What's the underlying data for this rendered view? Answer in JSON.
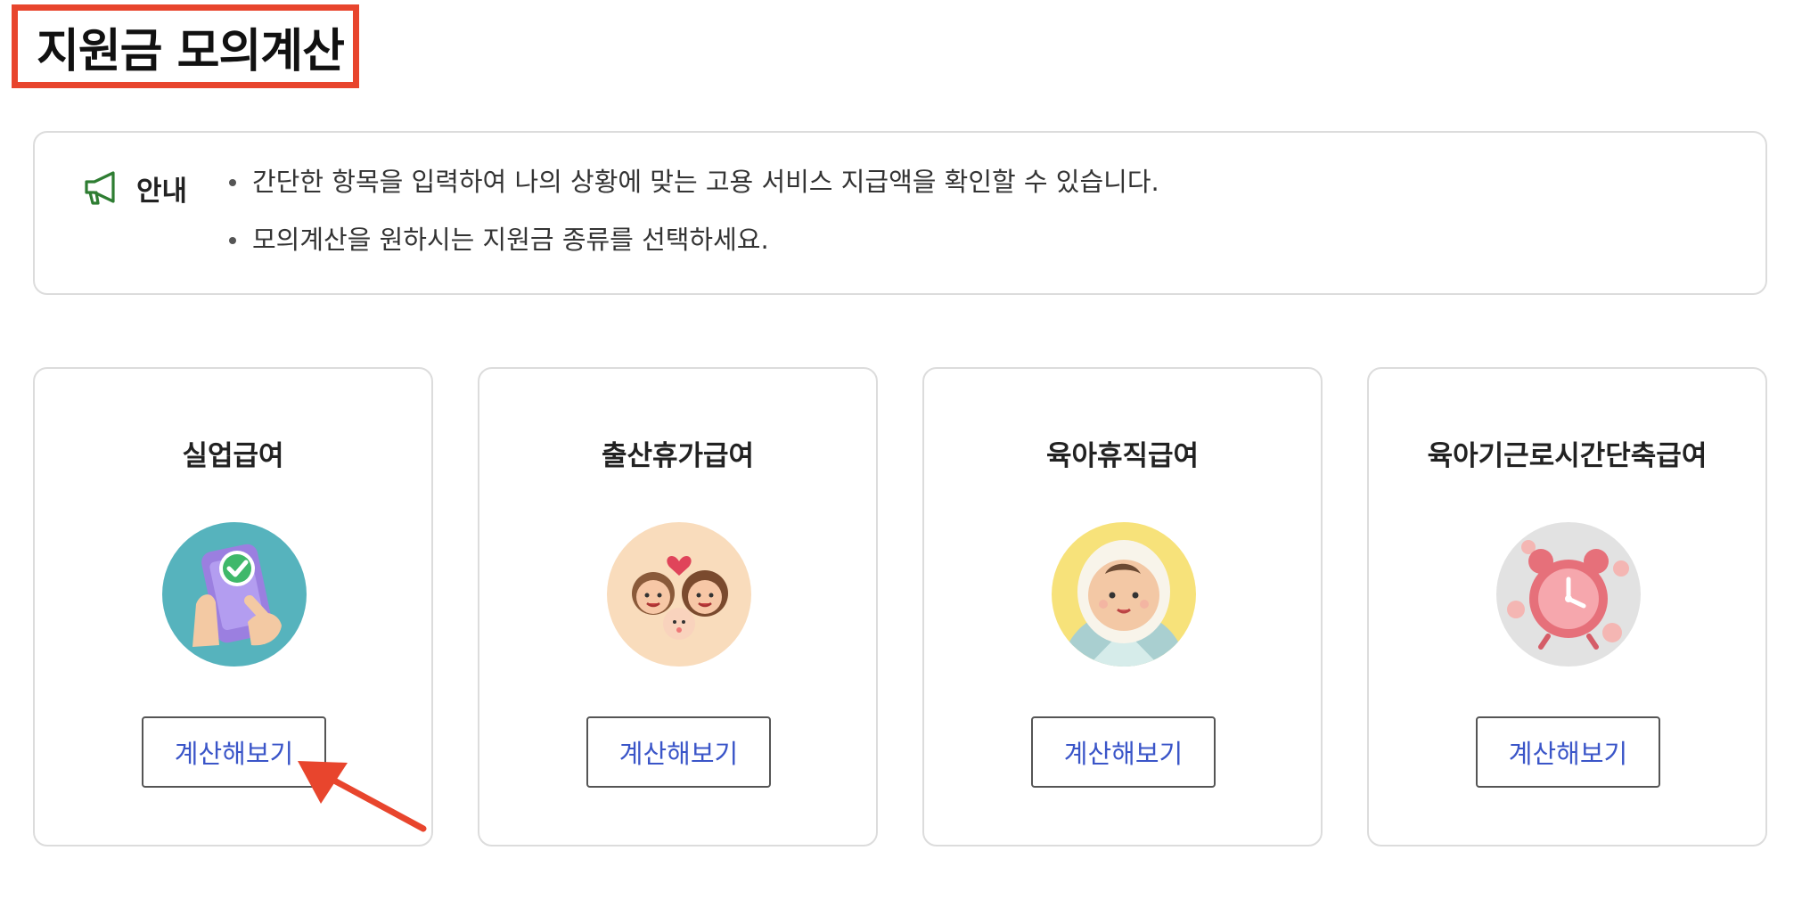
{
  "header": {
    "title": "지원금 모의계산"
  },
  "notice": {
    "icon": "megaphone-icon",
    "label": "안내",
    "lines": [
      "간단한 항목을 입력하여 나의 상황에 맞는 고용 서비스 지급액을 확인할 수 있습니다.",
      "모의계산을 원하시는 지원금 종류를 선택하세요."
    ]
  },
  "cards": [
    {
      "title": "실업급여",
      "image": "phone-checkmark-hands-illustration",
      "button_label": "계산해보기"
    },
    {
      "title": "출산휴가급여",
      "image": "family-with-baby-illustration",
      "button_label": "계산해보기"
    },
    {
      "title": "육아휴직급여",
      "image": "swaddled-baby-illustration",
      "button_label": "계산해보기"
    },
    {
      "title": "육아기근로시간단축급여",
      "image": "alarm-clock-coins-illustration",
      "button_label": "계산해보기"
    }
  ],
  "colors": {
    "title_highlight_border": "#e8452d",
    "annotation_arrow": "#e8452d",
    "button_text": "#3a55c8",
    "notice_icon": "#2e7d32",
    "card_border": "#dcdcdc"
  }
}
